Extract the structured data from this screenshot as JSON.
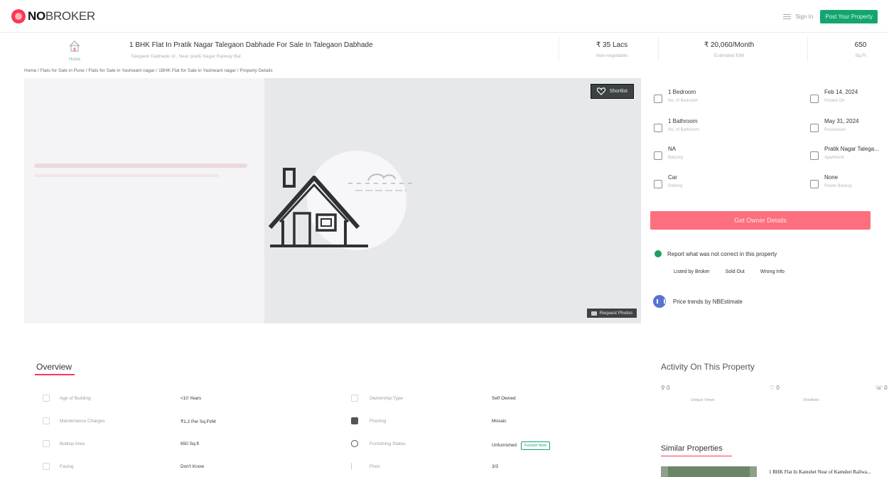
{
  "nav": {
    "logo_no": "NO",
    "logo_broker": "BROKER",
    "signin": "Sign In",
    "post_property": "Post Your Property",
    "accent": "#fd3752",
    "post_color": "#13a56f"
  },
  "header": {
    "home_caption": "Home",
    "title": "1 BHK Flat In Pratik Nagar Talegaon Dabhade For Sale In Talegaon Dabhade",
    "subtitle": "Talegaon Dabhade rd , Near pratik Nagar Railway Bal",
    "price": "₹ 35 Lacs",
    "price_caption": "Non-negotiable",
    "emi": "₹ 20,060/Month",
    "emi_caption": "Estimated EMI",
    "area": "650",
    "area_caption": "Sq.Ft"
  },
  "breadcrumb": "Home / Flats for Sale in Pune / Flats for Sale in Yashwant nagar / 1BHK Flat for Sale in Yashwant nagar / Property Details",
  "gallery": {
    "shortlist": "Shortlist",
    "request_photos": "Request Photos"
  },
  "details": [
    {
      "value": "1 Bedroom",
      "caption": "No. of Bedroom",
      "icon": "bed-icon"
    },
    {
      "value": "Feb 14, 2024",
      "caption": "Posted On",
      "icon": "calendar-icon"
    },
    {
      "value": "1 Bathroom",
      "caption": "No. of Bathroom",
      "icon": "bath-icon"
    },
    {
      "value": "May 31, 2024",
      "caption": "Possession",
      "icon": "key-icon"
    },
    {
      "value": "NA",
      "caption": "Balcony",
      "icon": "balcony-icon"
    },
    {
      "value": "Pratik Nagar Talega...",
      "caption": "Apartment",
      "icon": "building-icon"
    },
    {
      "value": "Car",
      "caption": "Parking",
      "icon": "car-icon"
    },
    {
      "value": "None",
      "caption": "Power Backup",
      "icon": "power-icon"
    }
  ],
  "owner_button": "Get Owner Details",
  "report": {
    "text": "Report what was not correct in this property",
    "options": [
      "Listed by Broker",
      "Sold Out",
      "Wrong Info"
    ]
  },
  "trends": "Price trends by NBEstimate",
  "overview": {
    "title": "Overview",
    "rows": [
      {
        "l1": "Age of Building",
        "v1": "<10 Years",
        "l2": "Ownership Type",
        "v2": "Self Owned"
      },
      {
        "l1": "Maintenance Charges",
        "v1": "₹1.2 Per Sq.Ft/M",
        "l2": "Flooring",
        "v2": "Mosaic"
      },
      {
        "l1": "Builtup Area",
        "v1": "650 Sq.ft",
        "l2": "Furnishing Status",
        "v2": "Unfurnished"
      },
      {
        "l1": "Facing",
        "v1": "Don't Know",
        "l2": "Floor",
        "v2": "3/3"
      }
    ],
    "furnish_now": "Furnish Now"
  },
  "activity": {
    "title": "Activity On This Property",
    "views": "0",
    "views_caption": "Unique Views",
    "shortlists": "0",
    "shortlists_caption": "Shortlists",
    "contacts": "0"
  },
  "similar": {
    "title": "Similar Properties",
    "first_item": "1 BHK Flat In Kamshet Near of Kamshet Railwa..."
  }
}
